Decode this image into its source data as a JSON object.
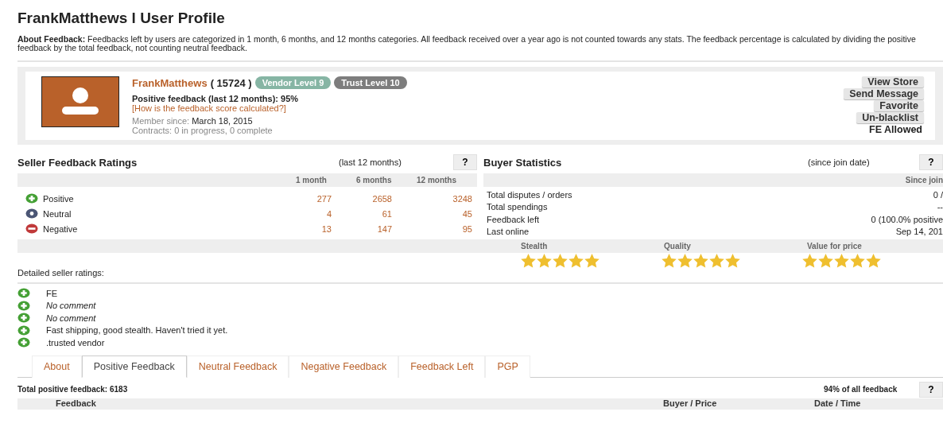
{
  "title": "FrankMatthews l User Profile",
  "about": {
    "label": "About Feedback:",
    "text": "Feedbacks left by users are categorized in 1 month, 6 months, and 12 months categories. All feedback received over a year ago is not counted towards any stats. The feedback percentage is calculated by dividing the positive feedback by the total feedback, not counting neutral feedback."
  },
  "profile": {
    "name": "FrankMatthews",
    "score": "( 15724 )",
    "badges": [
      {
        "label": "Vendor Level 9",
        "color": "#86b5a4"
      },
      {
        "label": "Trust Level 10",
        "color": "#7d7d7d"
      }
    ],
    "positive": "Positive feedback (last 12 months): 95%",
    "how_link": "[How is the feedback score calculated?]",
    "member_label": "Member since:",
    "member_date": "March 18, 2015",
    "contracts": "Contracts: 0 in progress, 0 complete",
    "actions": [
      "View Store",
      "Send Message",
      "Favorite",
      "Un-blacklist"
    ],
    "fe_status": "FE Allowed"
  },
  "seller": {
    "title": "Seller Feedback Ratings",
    "period": "(last 12 months)",
    "help": "?",
    "columns": [
      "1 month",
      "6 months",
      "12 months"
    ],
    "rows": [
      {
        "kind": "positive",
        "label": "Positive",
        "values": [
          "277",
          "2658",
          "3248"
        ]
      },
      {
        "kind": "neutral",
        "label": "Neutral",
        "values": [
          "4",
          "61",
          "45"
        ]
      },
      {
        "kind": "negative",
        "label": "Negative",
        "values": [
          "13",
          "147",
          "95"
        ]
      }
    ]
  },
  "buyer": {
    "title": "Buyer Statistics",
    "period": "(since join date)",
    "help": "?",
    "column": "Since join",
    "rows": [
      {
        "label": "Total disputes / orders",
        "value": "0 /"
      },
      {
        "label": "Total spendings",
        "value": "--"
      },
      {
        "label": "Feedback left",
        "value": "0 (100.0% positive"
      },
      {
        "label": "Last online",
        "value": "Sep 14, 201"
      }
    ],
    "ratings": [
      {
        "label": "Stealth",
        "stars": 5
      },
      {
        "label": "Quality",
        "stars": 5
      },
      {
        "label": "Value for price",
        "stars": 5
      }
    ]
  },
  "detailed": {
    "title": "Detailed seller ratings:",
    "items": [
      {
        "kind": "positive",
        "text": "FE",
        "italic": false
      },
      {
        "kind": "positive",
        "text": "No comment",
        "italic": true
      },
      {
        "kind": "positive",
        "text": "No comment",
        "italic": true
      },
      {
        "kind": "positive",
        "text": "Fast shipping, good stealth. Haven't tried it yet.",
        "italic": false
      },
      {
        "kind": "positive",
        "text": ".trusted vendor",
        "italic": false
      }
    ]
  },
  "tabs": [
    {
      "label": "About",
      "selected": false
    },
    {
      "label": "Positive Feedback",
      "selected": true
    },
    {
      "label": "Neutral Feedback",
      "selected": false
    },
    {
      "label": "Negative Feedback",
      "selected": false
    },
    {
      "label": "Feedback Left",
      "selected": false
    },
    {
      "label": "PGP",
      "selected": false
    }
  ],
  "feedback": {
    "total": "Total positive feedback: 6183",
    "share": "94% of all feedback",
    "help": "?",
    "columns": [
      "Feedback",
      "Buyer / Price",
      "Date / Time"
    ]
  }
}
